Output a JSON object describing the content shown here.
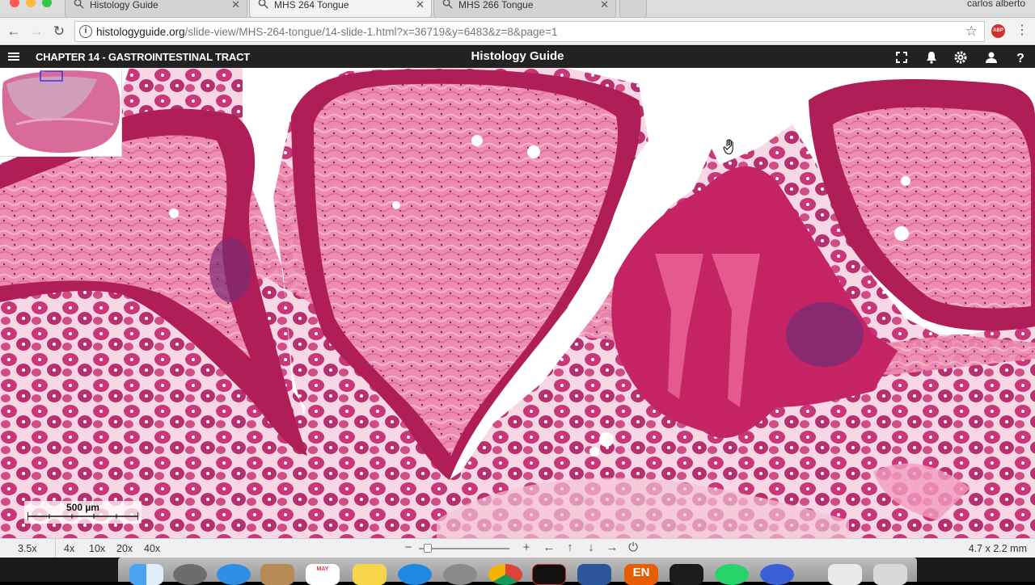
{
  "browser": {
    "user": "carlos alberto",
    "tabs": [
      {
        "title": "Histology Guide",
        "active": false
      },
      {
        "title": "MHS 264 Tongue",
        "active": true
      },
      {
        "title": "MHS 266 Tongue",
        "active": false
      }
    ],
    "url_host": "histologyguide.org",
    "url_path": "/slide-view/MHS-264-tongue/14-slide-1.html?x=36719&y=6483&z=8&page=1",
    "abp_label": "ABP"
  },
  "header": {
    "chapter": "CHAPTER 14 - GASTROINTESTINAL TRACT",
    "brand": "Histology Guide",
    "icons": [
      "menu-icon",
      "fullscreen-icon",
      "bell-icon",
      "gear-icon",
      "user-icon",
      "help-icon"
    ]
  },
  "viewer": {
    "scale_label": "500 µm",
    "tissue_colors": {
      "epithelium": "#b01e57",
      "lamina": "#ee8db0",
      "gland": "#c83a78",
      "lumen": "#ffffff"
    }
  },
  "controls": {
    "current_zoom": "3.5x",
    "zoom_levels": [
      "4x",
      "10x",
      "20x",
      "40x"
    ],
    "dimensions": "4.7 x 2.2 mm",
    "minus": "−",
    "plus": "+",
    "nav_left": "←",
    "nav_up": "↑",
    "nav_down": "↓",
    "nav_right": "→",
    "reset": "⏻"
  },
  "dock": {
    "apps": [
      "finder",
      "launchpad",
      "safari",
      "notes-folder",
      "calendar",
      "notes",
      "app-store",
      "system-preferences",
      "chrome",
      "terminal-app",
      "word",
      "language-en",
      "activity-monitor",
      "whatsapp",
      "other-app",
      "files",
      "trash"
    ],
    "calendar_month": "MAY",
    "en_label": "EN"
  }
}
